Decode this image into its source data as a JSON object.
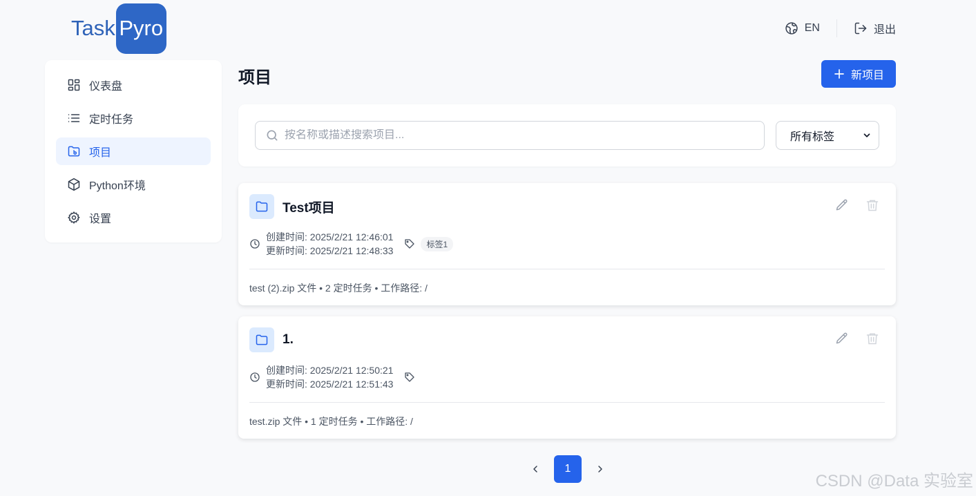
{
  "brand": {
    "part1": "Task",
    "part2": "Pyro"
  },
  "header": {
    "lang_label": "EN",
    "logout_label": "退出"
  },
  "sidebar": {
    "items": [
      {
        "label": "仪表盘",
        "icon": "dashboard-icon"
      },
      {
        "label": "定时任务",
        "icon": "list-icon"
      },
      {
        "label": "项目",
        "icon": "folder-icon",
        "active": true
      },
      {
        "label": "Python环境",
        "icon": "cube-icon"
      },
      {
        "label": "设置",
        "icon": "gear-icon"
      }
    ]
  },
  "main": {
    "title": "项目",
    "new_button": "新项目",
    "search": {
      "placeholder": "按名称或描述搜索项目..."
    },
    "tag_filter": {
      "selected": "所有标签"
    },
    "projects": [
      {
        "name": "Test项目",
        "created": "创建时间: 2025/2/21 12:46:01",
        "updated": "更新时间: 2025/2/21 12:48:33",
        "tags": [
          "标签1"
        ],
        "footer": "test (2).zip 文件 • 2 定时任务 • 工作路径: /"
      },
      {
        "name": "1.",
        "created": "创建时间: 2025/2/21 12:50:21",
        "updated": "更新时间: 2025/2/21 12:51:43",
        "tags": [],
        "footer": "test.zip 文件 • 1 定时任务 • 工作路径: /"
      }
    ]
  },
  "pagination": {
    "current": "1"
  },
  "watermark": "CSDN @Data 实验室",
  "colors": {
    "primary": "#2563eb",
    "logo_bg": "#2e67c6",
    "active_bg": "#eef4ff"
  }
}
